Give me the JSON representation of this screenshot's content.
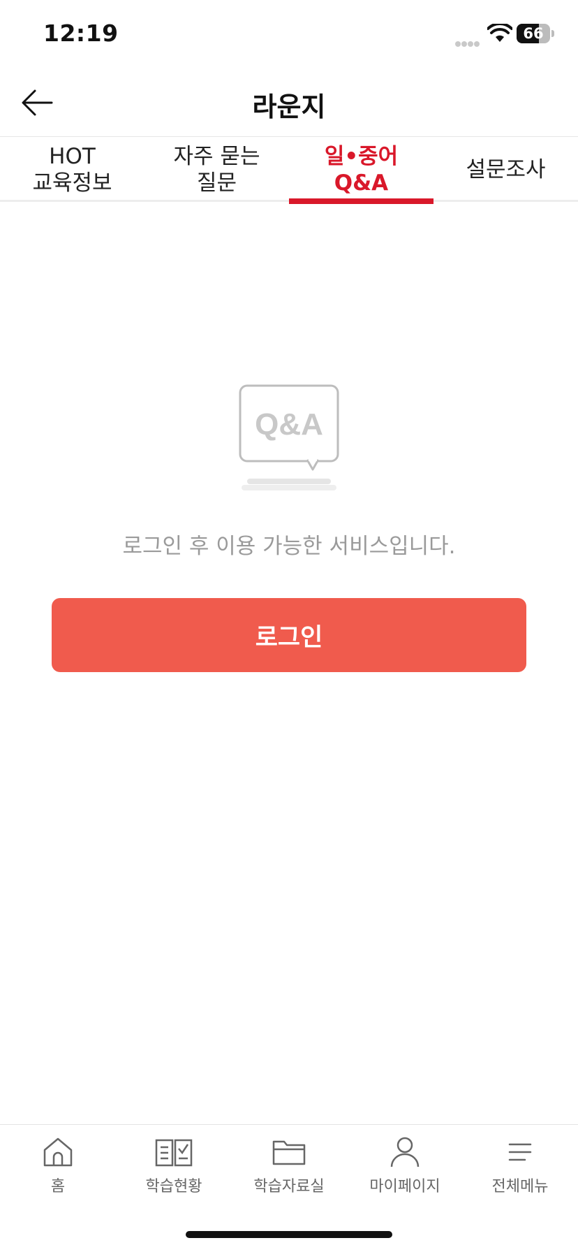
{
  "status_bar": {
    "time": "12:19",
    "battery": "66",
    "battery_level": 0.66
  },
  "header": {
    "title": "라운지",
    "back_icon": "arrow-left-icon"
  },
  "tabs": [
    {
      "label": "HOT\n교육정보",
      "active": false
    },
    {
      "label": "자주 묻는\n질문",
      "active": false
    },
    {
      "label": "일•중어\nQ&A",
      "active": true
    },
    {
      "label": "설문조사",
      "active": false
    }
  ],
  "empty_state": {
    "illustration_text": "Q&A",
    "message": "로그인 후 이용 가능한 서비스입니다.",
    "button_label": "로그인",
    "button_color": "#f05b4d"
  },
  "bottom_nav": [
    {
      "label": "홈",
      "icon": "home-icon"
    },
    {
      "label": "학습현황",
      "icon": "book-check-icon"
    },
    {
      "label": "학습자료실",
      "icon": "folder-icon"
    },
    {
      "label": "마이페이지",
      "icon": "person-icon"
    },
    {
      "label": "전체메뉴",
      "icon": "menu-icon"
    }
  ],
  "colors": {
    "accent": "#d9182a",
    "button": "#f05b4d"
  }
}
